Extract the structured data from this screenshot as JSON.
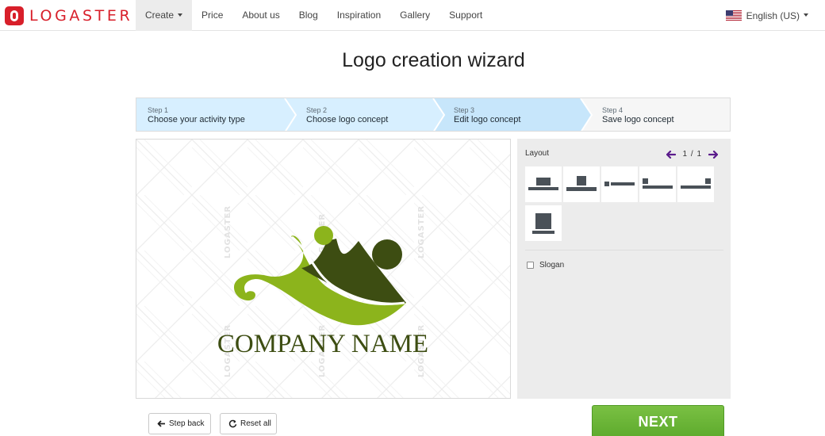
{
  "brand": {
    "name": "LOGASTER",
    "color": "#d81f2a"
  },
  "nav": {
    "items": [
      {
        "label": "Create",
        "active": true,
        "has_caret": true
      },
      {
        "label": "Price"
      },
      {
        "label": "About us"
      },
      {
        "label": "Blog"
      },
      {
        "label": "Inspiration"
      },
      {
        "label": "Gallery"
      },
      {
        "label": "Support"
      }
    ],
    "language": "English (US)"
  },
  "page": {
    "title": "Logo creation wizard"
  },
  "steps": [
    {
      "number": "Step 1",
      "label": "Choose your activity type",
      "state": "completed"
    },
    {
      "number": "Step 2",
      "label": "Choose logo concept",
      "state": "completed"
    },
    {
      "number": "Step 3",
      "label": "Edit logo concept",
      "state": "current"
    },
    {
      "number": "Step 4",
      "label": "Save logo concept",
      "state": "upcoming"
    }
  ],
  "preview": {
    "company_name": "COMPANY NAME",
    "watermark": "LOGASTER",
    "logo_colors": {
      "dark": "#3d4d12",
      "light": "#8cb41c"
    }
  },
  "panel": {
    "layout_title": "Layout",
    "pager": {
      "current": "1",
      "separator": "/",
      "total": "1"
    },
    "layout_options_count": 6,
    "slogan_label": "Slogan",
    "slogan_checked": false
  },
  "actions": {
    "step_back": "Step back",
    "reset_all": "Reset all",
    "next": "NEXT"
  },
  "colors": {
    "step_done": "#d7efff",
    "step_current": "#c7e6fb",
    "step_upcoming": "#f6f6f6",
    "next_button": "#6bb537",
    "pager_arrow": "#5b1c8c"
  }
}
